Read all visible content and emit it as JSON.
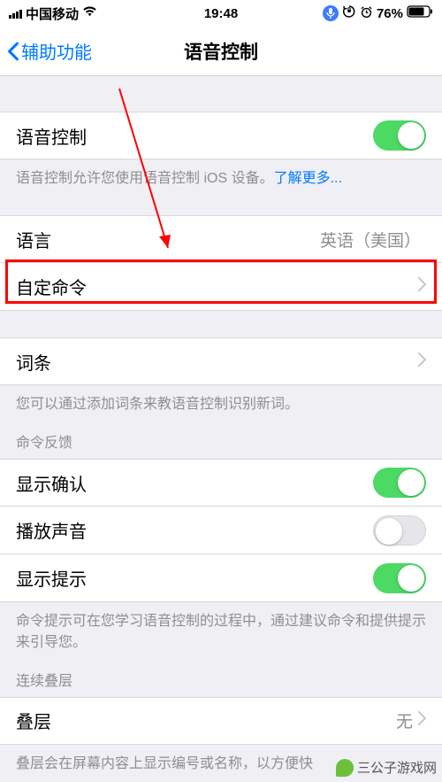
{
  "status": {
    "carrier": "中国移动",
    "time": "19:48",
    "battery": "76%"
  },
  "nav": {
    "back": "辅助功能",
    "title": "语音控制"
  },
  "rows": {
    "voice_control": "语音控制",
    "language_label": "语言",
    "language_value": "英语（美国）",
    "customize": "自定命令",
    "vocabulary": "词条",
    "show_confirm": "显示确认",
    "play_sound": "播放声音",
    "show_hints": "显示提示",
    "overlay": "叠层",
    "overlay_value": "无"
  },
  "footers": {
    "voice_control_desc": "语音控制允许您使用语音控制 iOS 设备。",
    "learn_more": "了解更多...",
    "vocabulary_desc": "您可以通过添加词条来教语音控制识别新词。",
    "hints_desc": "命令提示可在您学习语音控制的过程中，通过建议命令和提供提示来引导您。",
    "overlay_desc": "叠层会在屏幕内容上显示编号或名称，以方便快"
  },
  "headers": {
    "feedback": "命令反馈",
    "overlay": "连续叠层"
  },
  "switches": {
    "voice_control": true,
    "show_confirm": true,
    "play_sound": false,
    "show_hints": true
  },
  "watermark": "三公子游戏网"
}
